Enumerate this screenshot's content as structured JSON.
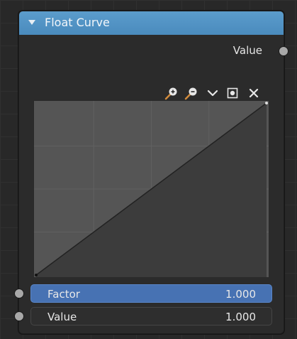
{
  "node": {
    "title": "Float Curve",
    "header_color": "#4a8bbd"
  },
  "outputs": [
    {
      "label": "Value"
    }
  ],
  "toolbar": {
    "icons": [
      "zoom-in-icon",
      "zoom-out-icon",
      "chevron-down-icon",
      "clipping-icon",
      "close-icon"
    ]
  },
  "curve": {
    "type": "line",
    "x": [
      0,
      1
    ],
    "y": [
      0,
      1
    ],
    "grid": true,
    "background_color": "#555555",
    "line_color": "#222222"
  },
  "inputs": [
    {
      "label": "Factor",
      "value": "1.000",
      "active": true,
      "accent": "#4772b3"
    },
    {
      "label": "Value",
      "value": "1.000",
      "active": false
    }
  ]
}
